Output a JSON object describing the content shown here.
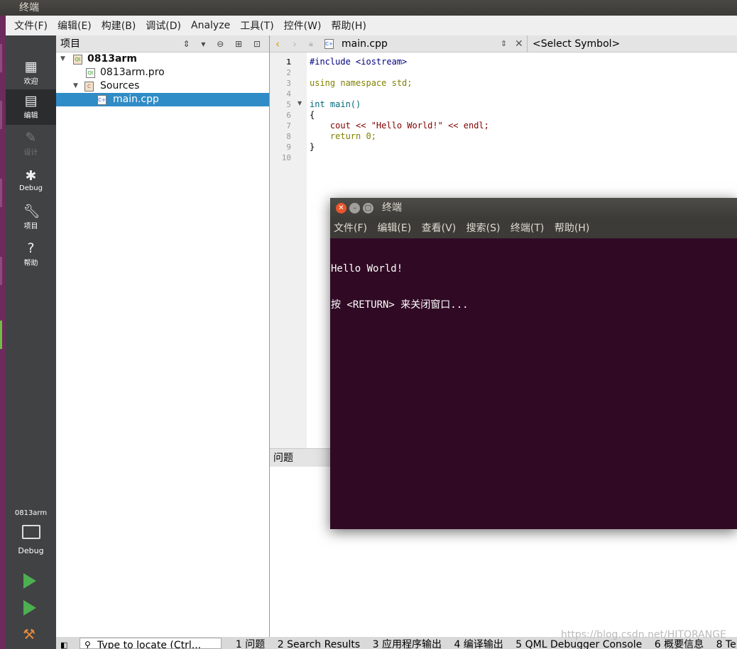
{
  "window_title": "终端",
  "menu": [
    "文件(F)",
    "编辑(E)",
    "构建(B)",
    "调试(D)",
    "Analyze",
    "工具(T)",
    "控件(W)",
    "帮助(H)"
  ],
  "modes": [
    {
      "label": "欢迎",
      "icon": "grid-icon"
    },
    {
      "label": "编辑",
      "icon": "edit-doc-icon"
    },
    {
      "label": "设计",
      "icon": "pencil-icon"
    },
    {
      "label": "Debug",
      "icon": "bug-icon"
    },
    {
      "label": "项目",
      "icon": "wrench-icon"
    },
    {
      "label": "帮助",
      "icon": "help-icon"
    }
  ],
  "kit": {
    "project": "0813arm",
    "build": "Debug"
  },
  "project_panel": {
    "title": "项目",
    "tree": [
      {
        "label": "0813arm"
      },
      {
        "label": "0813arm.pro"
      },
      {
        "label": "Sources"
      },
      {
        "label": "main.cpp"
      }
    ]
  },
  "editor": {
    "file": "main.cpp",
    "symbol": "<Select Symbol>",
    "line_numbers": [
      "1",
      "2",
      "3",
      "4",
      "5",
      "6",
      "7",
      "8",
      "9",
      "10"
    ],
    "code": [
      "#include <iostream>",
      "",
      "using namespace std;",
      "",
      "int main()",
      "{",
      "    cout << \"Hello World!\" << endl;",
      "    return 0;",
      "}",
      ""
    ]
  },
  "issues_title": "问题",
  "locator_placeholder": "Type to locate (Ctrl...",
  "output_tabs": [
    "1 问题",
    "2 Search Results",
    "3 应用程序输出",
    "4 编译输出",
    "5 QML Debugger Console",
    "6 概要信息",
    "8 Te"
  ],
  "terminal": {
    "title": "终端",
    "menu": [
      "文件(F)",
      "编辑(E)",
      "查看(V)",
      "搜索(S)",
      "终端(T)",
      "帮助(H)"
    ],
    "lines": [
      "Hello World!",
      "按 <RETURN> 来关闭窗口..."
    ]
  },
  "watermark": "https://blog.csdn.net/HITORANGE",
  "colors": {
    "terminal_bg": "#300a24",
    "selection": "#308cc6",
    "modebar": "#404244",
    "launcher": "#6c2a5d"
  }
}
